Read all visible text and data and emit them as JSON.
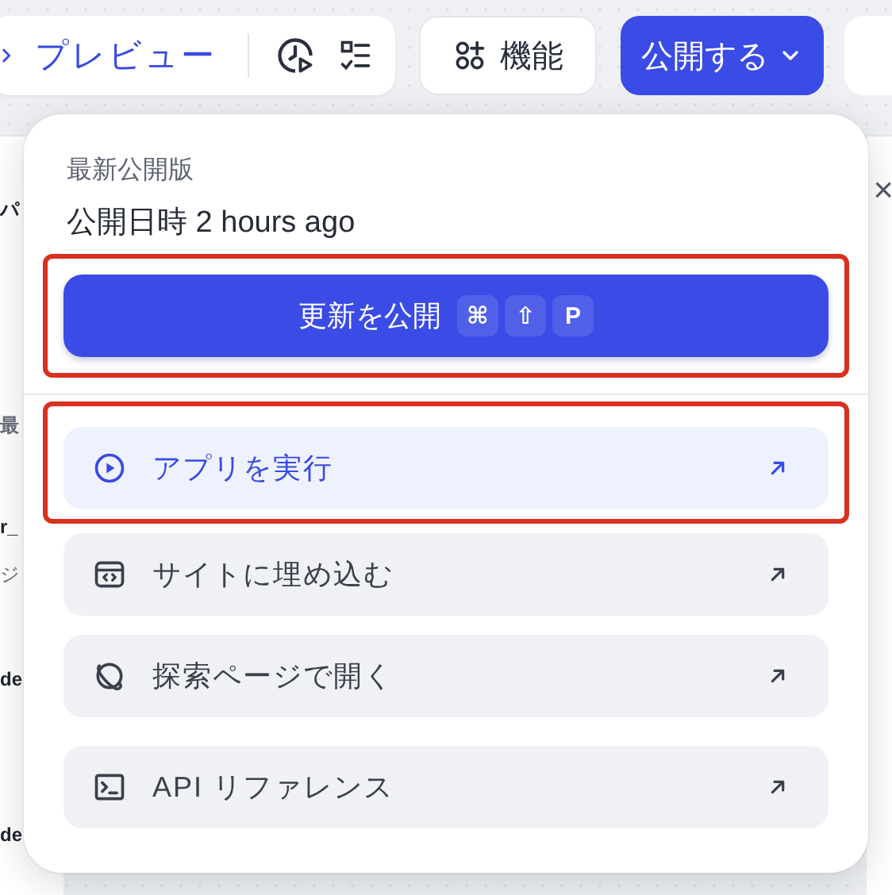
{
  "toolbar": {
    "preview_label": "プレビュー",
    "features_label": "機能",
    "publish_label": "公開する"
  },
  "background": {
    "fragments": [
      {
        "text": "パ",
        "kind": "title"
      },
      {
        "text": "最",
        "kind": "heading"
      },
      {
        "text": "r_",
        "kind": "name"
      },
      {
        "text": "ジ",
        "kind": "sub"
      },
      {
        "text": "de",
        "kind": "name"
      },
      {
        "text": "de",
        "kind": "name"
      }
    ],
    "close": "×"
  },
  "popover": {
    "heading": "最新公開版",
    "published": "公開日時 2 hours ago",
    "update_button": {
      "label": "更新を公開",
      "shortcut": [
        "⌘",
        "⇧",
        "P"
      ],
      "annotated": true
    },
    "items": [
      {
        "label": "アプリを実行",
        "kind": "play",
        "selected": true,
        "annotated": true
      },
      {
        "label": "サイトに埋め込む",
        "kind": "embed",
        "selected": false,
        "annotated": false
      },
      {
        "label": "探索ページで開く",
        "kind": "explore",
        "selected": false,
        "annotated": false
      },
      {
        "label": "API リファレンス",
        "kind": "terminal",
        "selected": false,
        "annotated": false
      }
    ]
  }
}
